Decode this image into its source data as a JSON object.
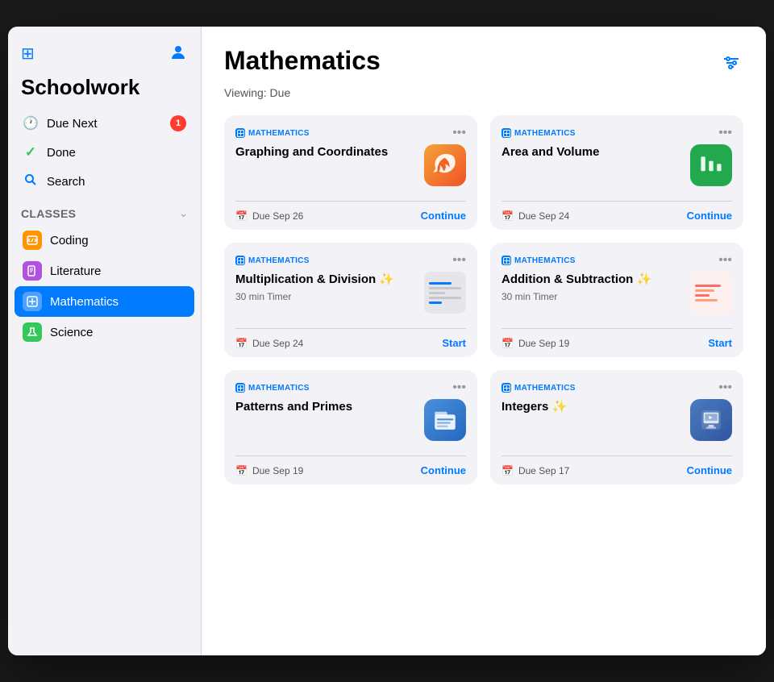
{
  "sidebar": {
    "toggle_icon": "⊞",
    "user_icon": "👤",
    "title": "Schoolwork",
    "nav": [
      {
        "id": "due-next",
        "label": "Due Next",
        "icon": "🕐",
        "badge": "1"
      },
      {
        "id": "done",
        "label": "Done",
        "icon": "✓",
        "badge": null
      },
      {
        "id": "search",
        "label": "Search",
        "icon": "🔍",
        "badge": null
      }
    ],
    "classes_section": "Classes",
    "classes": [
      {
        "id": "coding",
        "label": "Coding",
        "icon_color": "orange",
        "active": false
      },
      {
        "id": "literature",
        "label": "Literature",
        "icon_color": "purple",
        "active": false
      },
      {
        "id": "mathematics",
        "label": "Mathematics",
        "icon_color": "blue",
        "active": true
      },
      {
        "id": "science",
        "label": "Science",
        "icon_color": "green",
        "active": false
      }
    ]
  },
  "main": {
    "title": "Mathematics",
    "viewing_label": "Viewing: Due",
    "filter_icon": "⊟",
    "cards": [
      {
        "id": "graphing",
        "class_label": "Mathematics",
        "title": "Graphing and Coordinates",
        "subtitle": null,
        "app_type": "swift",
        "due": "Due Sep 26",
        "action": "Continue"
      },
      {
        "id": "area-volume",
        "class_label": "Mathematics",
        "title": "Area and Volume",
        "subtitle": null,
        "app_type": "numbers",
        "due": "Due Sep 24",
        "action": "Continue"
      },
      {
        "id": "multiplication",
        "class_label": "Mathematics",
        "title": "Multiplication & Division ✨",
        "subtitle": "30 min Timer",
        "app_type": "thumbnail",
        "due": "Due Sep 24",
        "action": "Start"
      },
      {
        "id": "addition",
        "class_label": "Mathematics",
        "title": "Addition & Subtraction ✨",
        "subtitle": "30 min Timer",
        "app_type": "thumbnail2",
        "due": "Due Sep 19",
        "action": "Start"
      },
      {
        "id": "patterns",
        "class_label": "Mathematics",
        "title": "Patterns and Primes",
        "subtitle": null,
        "app_type": "files",
        "due": "Due Sep 19",
        "action": "Continue"
      },
      {
        "id": "integers",
        "class_label": "Mathematics",
        "title": "Integers ✨",
        "subtitle": null,
        "app_type": "keynote",
        "due": "Due Sep 17",
        "action": "Continue"
      }
    ]
  }
}
